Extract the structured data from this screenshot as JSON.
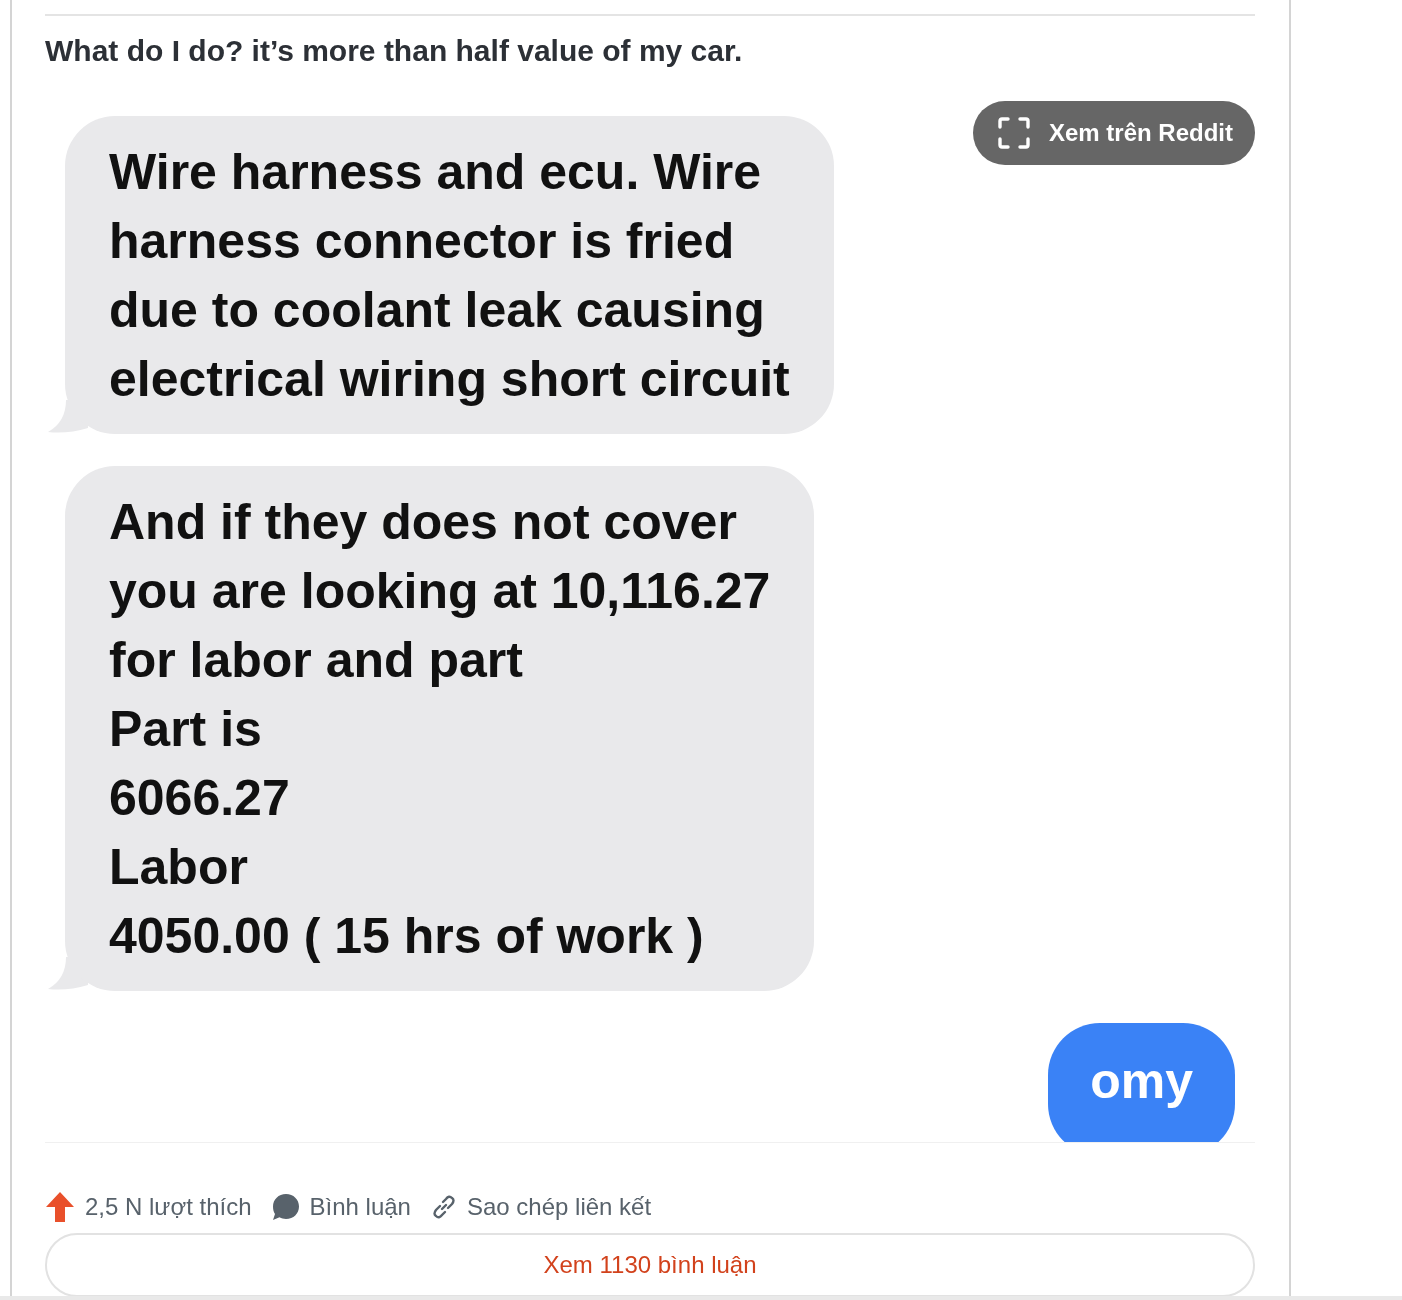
{
  "post": {
    "title": "What do I do? it’s more than half value of my car."
  },
  "image": {
    "messages": [
      {
        "kind": "received",
        "lines": [
          "Wire harness and ecu. Wire",
          "harness connector is fried",
          "due to coolant leak causing",
          "electrical wiring short circuit"
        ]
      },
      {
        "kind": "received",
        "lines": [
          "And if they does not cover",
          "you are looking at 10,116.27",
          "for labor and part",
          "Part is",
          "6066.27",
          "Labor",
          "4050.00 ( 15 hrs of work )"
        ]
      },
      {
        "kind": "sent",
        "lines": [
          "omy"
        ]
      }
    ]
  },
  "view_on_reddit": {
    "label": "Xem trên Reddit"
  },
  "actions": {
    "upvotes": "2,5 N lượt thích",
    "comments": "Bình luận",
    "copy_link": "Sao chép liên kết"
  },
  "view_comments": {
    "label": "Xem 1130 bình luận"
  }
}
